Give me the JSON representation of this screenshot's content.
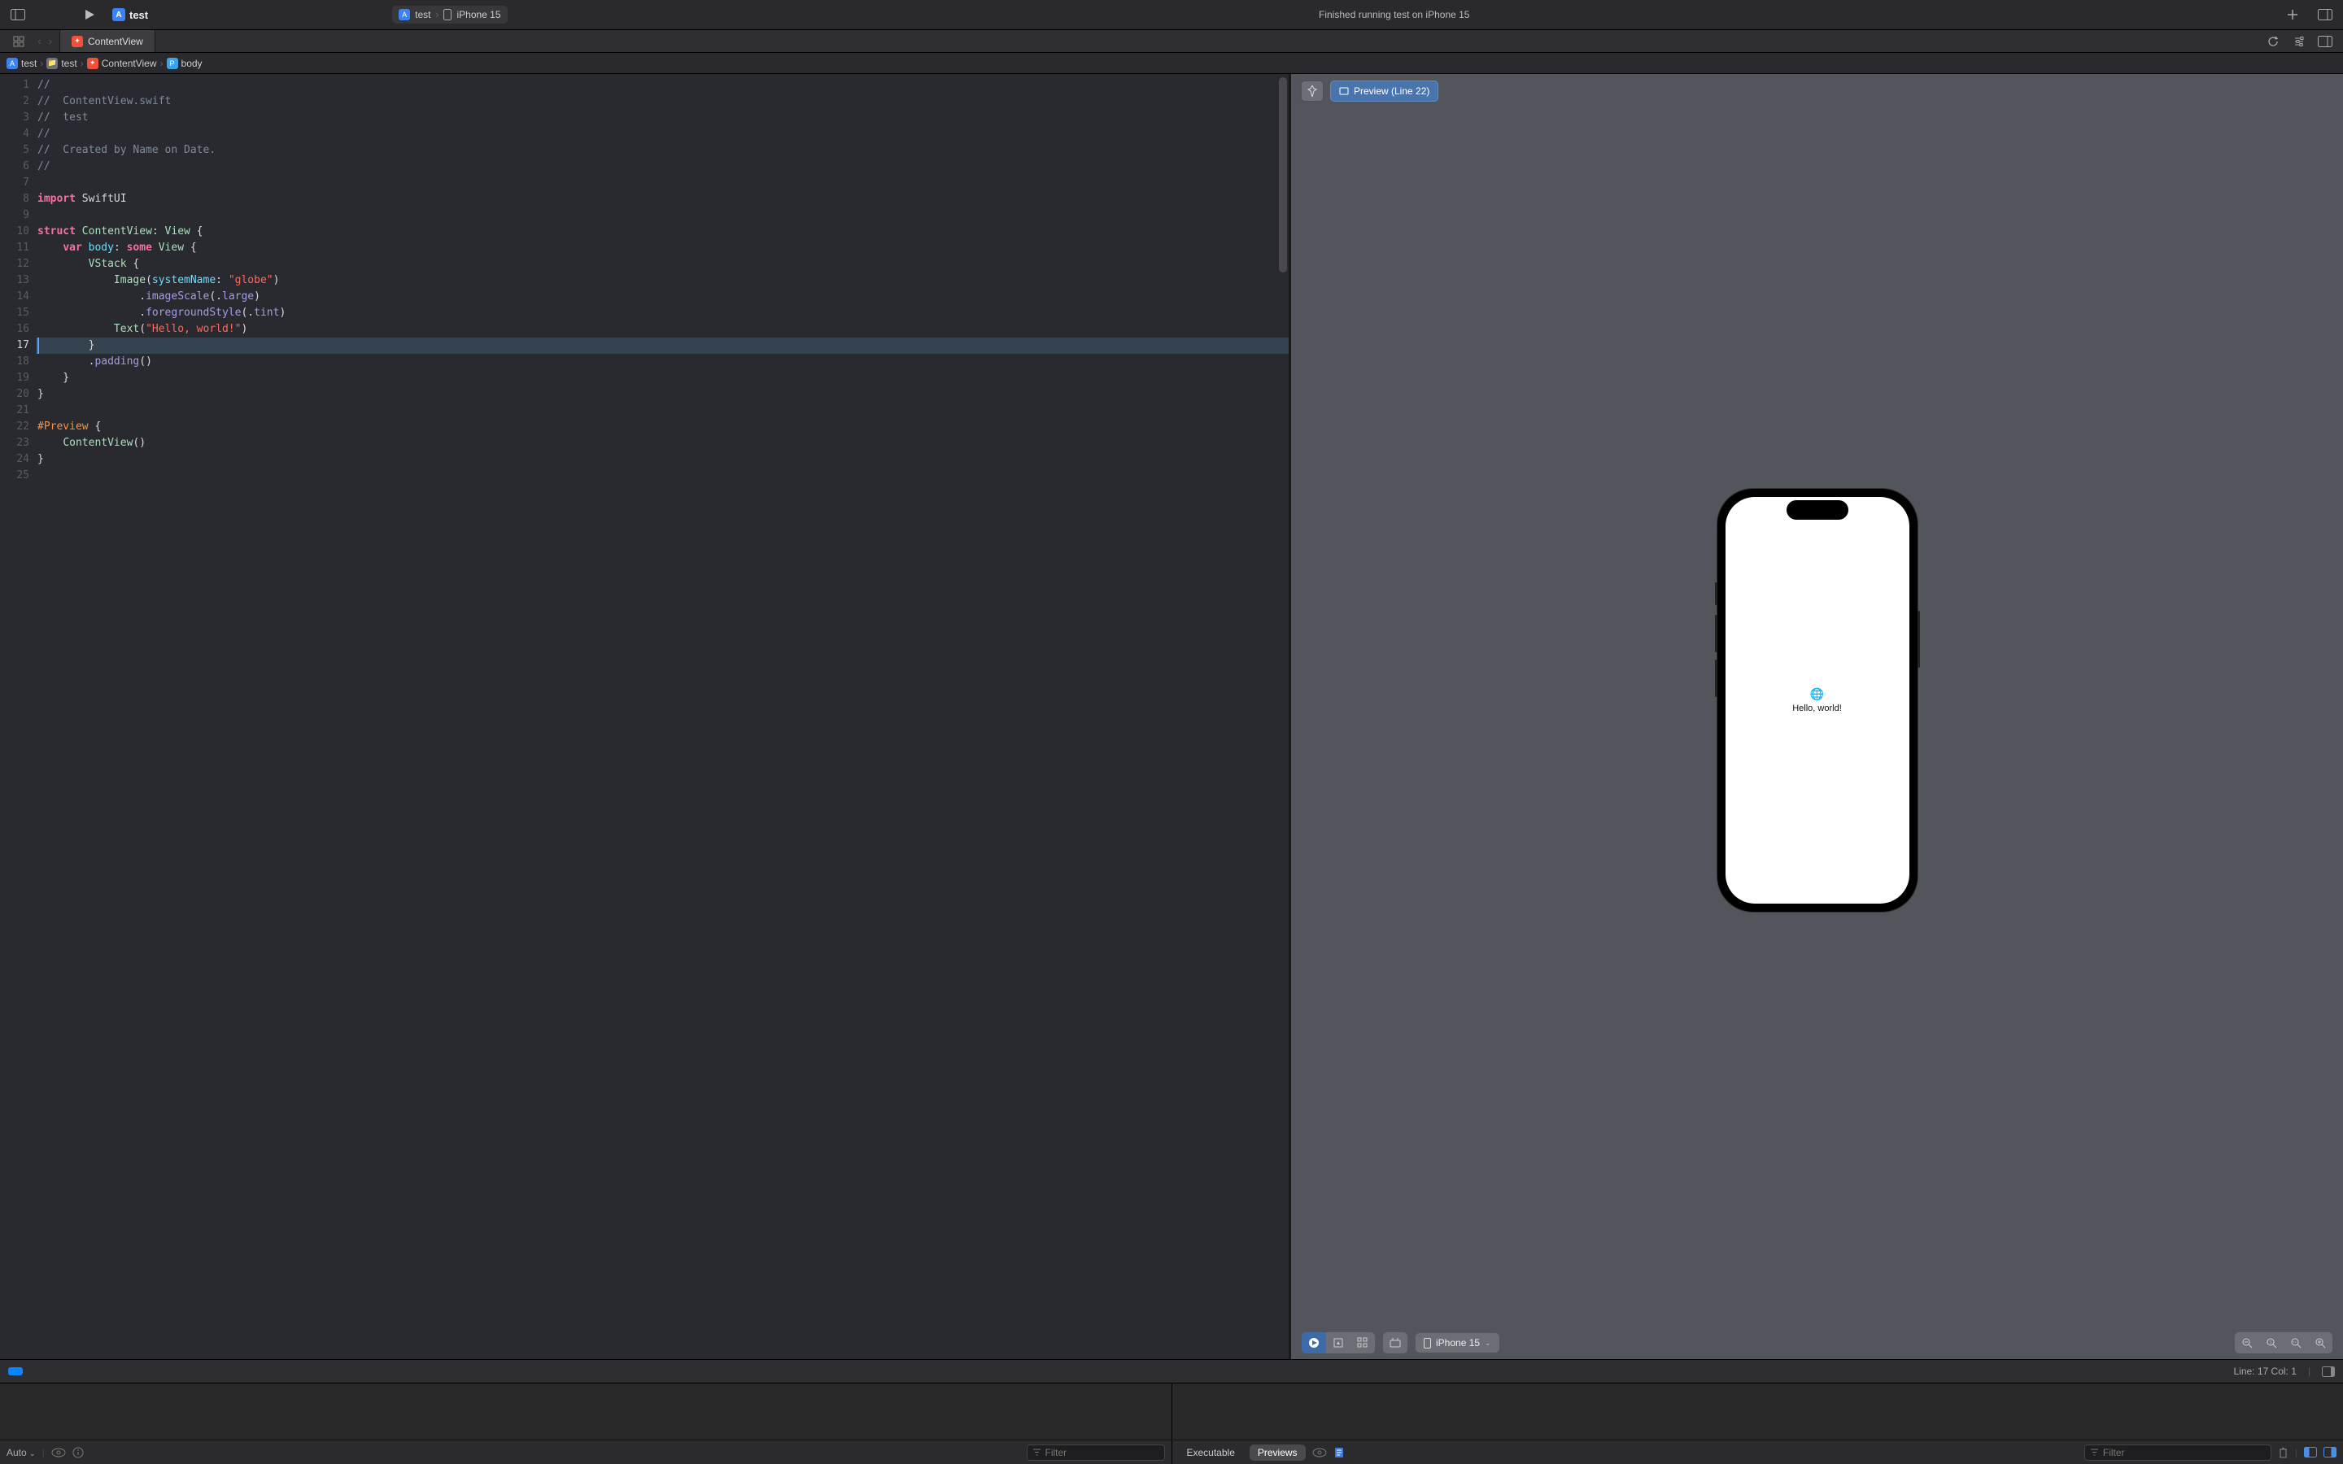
{
  "toolbar": {
    "scheme_name": "test",
    "target_scheme": "test",
    "target_device": "iPhone 15",
    "status_text": "Finished running test on iPhone 15"
  },
  "tabbar": {
    "tab_label": "ContentView"
  },
  "breadcrumb": {
    "items": [
      "test",
      "test",
      "ContentView",
      "body"
    ]
  },
  "editor": {
    "line_count": 25,
    "highlighted_line": 17,
    "lines": [
      {
        "n": 1,
        "html": "<span class='tok-comment'>//</span>"
      },
      {
        "n": 2,
        "html": "<span class='tok-comment'>//  ContentView.swift</span>"
      },
      {
        "n": 3,
        "html": "<span class='tok-comment'>//  test</span>"
      },
      {
        "n": 4,
        "html": "<span class='tok-comment'>//</span>"
      },
      {
        "n": 5,
        "html": "<span class='tok-comment'>//  Created by Name on Date.</span>"
      },
      {
        "n": 6,
        "html": "<span class='tok-comment'>//</span>"
      },
      {
        "n": 7,
        "html": ""
      },
      {
        "n": 8,
        "html": "<span class='tok-key'>import</span> SwiftUI"
      },
      {
        "n": 9,
        "html": ""
      },
      {
        "n": 10,
        "html": "<span class='tok-key'>struct</span> <span class='tok-type'>ContentView</span>: <span class='tok-type'>View</span> {"
      },
      {
        "n": 11,
        "html": "    <span class='tok-key'>var</span> <span class='tok-prop'>body</span>: <span class='tok-key'>some</span> <span class='tok-type'>View</span> {"
      },
      {
        "n": 12,
        "html": "        <span class='tok-type'>VStack</span> {"
      },
      {
        "n": 13,
        "html": "            <span class='tok-type'>Image</span>(<span class='tok-arg'>systemName</span>: <span class='tok-str'>\"globe\"</span>)"
      },
      {
        "n": 14,
        "html": "                .<span class='tok-func'>imageScale</span>(.<span class='tok-enum'>large</span>)"
      },
      {
        "n": 15,
        "html": "                .<span class='tok-func'>foregroundStyle</span>(.<span class='tok-enum'>tint</span>)"
      },
      {
        "n": 16,
        "html": "            <span class='tok-type'>Text</span>(<span class='tok-str'>\"Hello, world!\"</span>)"
      },
      {
        "n": 17,
        "html": "        }"
      },
      {
        "n": 18,
        "html": "        .<span class='tok-func'>padding</span>()"
      },
      {
        "n": 19,
        "html": "    }"
      },
      {
        "n": 20,
        "html": "}"
      },
      {
        "n": 21,
        "html": ""
      },
      {
        "n": 22,
        "html": "<span class='tok-preview'>#Preview</span> {"
      },
      {
        "n": 23,
        "html": "    <span class='tok-type'>ContentView</span>()"
      },
      {
        "n": 24,
        "html": "}"
      },
      {
        "n": 25,
        "html": ""
      }
    ]
  },
  "preview": {
    "chip_label": "Preview (Line 22)",
    "app_text": "Hello, world!",
    "device_label": "iPhone 15"
  },
  "statusbar": {
    "position": "Line: 17  Col: 1"
  },
  "debug": {
    "left_auto": "Auto",
    "left_filter_placeholder": "Filter",
    "right_filter_placeholder": "Filter",
    "executable_label": "Executable",
    "previews_label": "Previews"
  }
}
